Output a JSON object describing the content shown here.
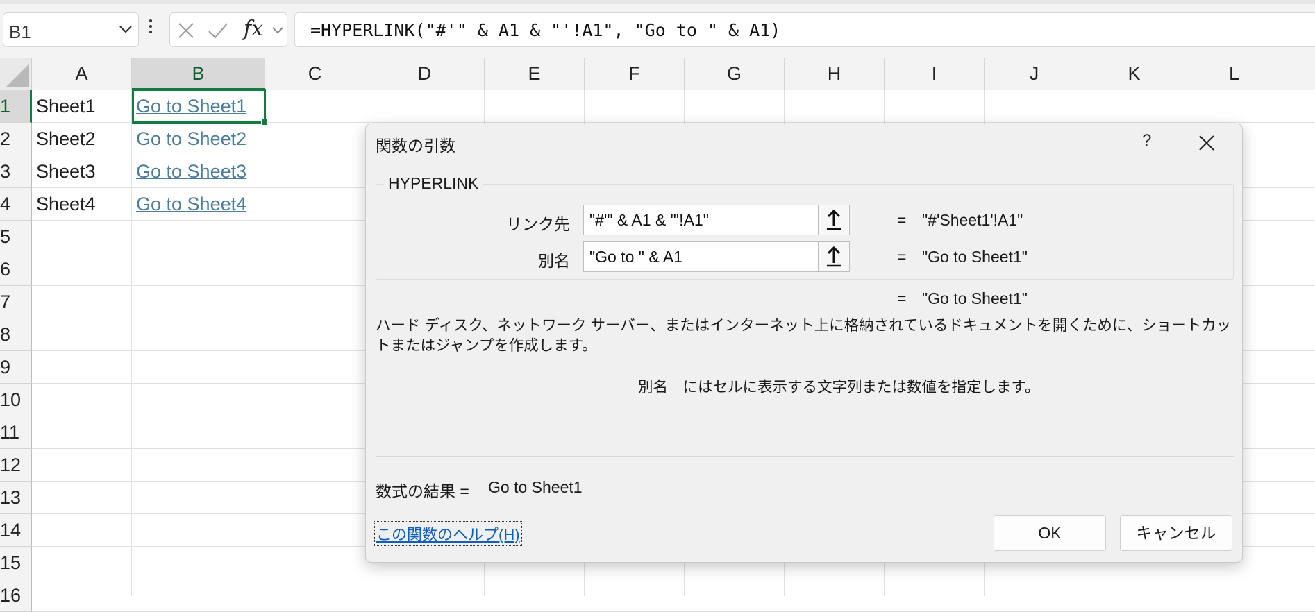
{
  "formula_bar": {
    "name_box": "B1",
    "formula": "=HYPERLINK(\"#'\" & A1 & \"'!A1\", \"Go to \" & A1)",
    "icons": [
      "chevron-down-icon",
      "more-options-icon",
      "cancel-x-icon",
      "enter-check-icon",
      "insert-function-fx-icon",
      "expand-chevron-icon"
    ],
    "fx_label": "fx"
  },
  "sheet": {
    "columns": [
      "A",
      "B",
      "C",
      "D",
      "E",
      "F",
      "G",
      "H",
      "I",
      "J",
      "K",
      "L"
    ],
    "selected_column": "B",
    "rows": [
      "1",
      "2",
      "3",
      "4",
      "5",
      "6",
      "7",
      "8",
      "9",
      "10",
      "11",
      "12",
      "13",
      "14",
      "15",
      "16"
    ],
    "selected_row": "1",
    "col_a_values": [
      "Sheet1",
      "Sheet2",
      "Sheet3",
      "Sheet4"
    ],
    "col_b_values": [
      "Go to Sheet1",
      "Go to Sheet2",
      "Go to Sheet3",
      "Go to Sheet4"
    ],
    "link_color": "#4d7d99",
    "selection_color": "#107c41"
  },
  "dialog": {
    "title": "関数の引数",
    "help_symbol": "?",
    "function_name": "HYPERLINK",
    "args": [
      {
        "label": "リンク先",
        "value": "\"#'\" & A1 & \"'!A1\"",
        "equals": "=",
        "result": "\"#'Sheet1'!A1\""
      },
      {
        "label": "別名",
        "value": "\"Go to \" & A1",
        "equals": "=",
        "result": "\"Go to Sheet1\""
      }
    ],
    "overall_equals": "=",
    "overall_result": "\"Go to Sheet1\"",
    "description": "ハード ディスク、ネットワーク サーバー、またはインターネット上に格納されているドキュメントを開くために、ショートカットまたはジャンプを作成します。",
    "arg_description_name": "別名",
    "arg_description_text": "にはセルに表示する文字列または数値を指定します。",
    "formula_result_label": "数式の結果 =",
    "formula_result_value": "Go to Sheet1",
    "help_link": "この関数のヘルプ(H)",
    "ok_label": "OK",
    "cancel_label": "キャンセル",
    "collapse_icon": "collapse-dialog-arrow-icon"
  }
}
